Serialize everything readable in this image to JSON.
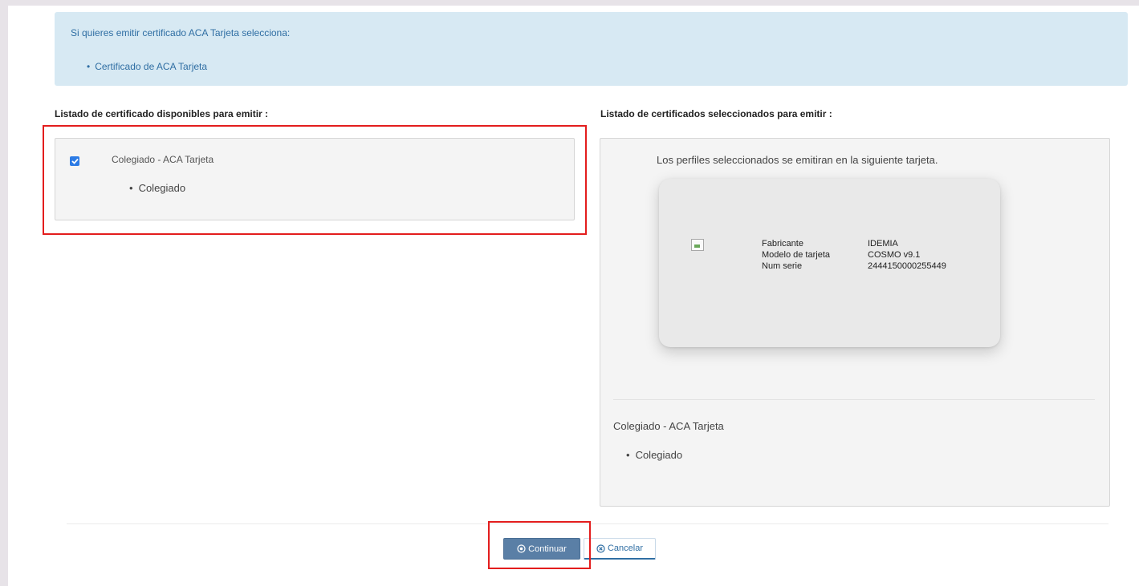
{
  "info": {
    "title": "Si quieres emitir certificado ACA Tarjeta selecciona:",
    "items": [
      "Certificado de ACA Tarjeta"
    ]
  },
  "available": {
    "heading": "Listado de certificado disponibles para emitir :",
    "item_name": "Colegiado - ACA Tarjeta",
    "item_checked": true,
    "item_profiles": [
      "Colegiado"
    ]
  },
  "selected": {
    "heading": "Listado de certificados seleccionados para emitir :",
    "intro": "Los perfiles seleccionados se emitiran en la siguiente tarjeta.",
    "card": {
      "rows": [
        {
          "label": "Fabricante",
          "value": "IDEMIA"
        },
        {
          "label": "Modelo de tarjeta",
          "value": "COSMO v9.1"
        },
        {
          "label": "Num serie",
          "value": "2444150000255449"
        }
      ]
    },
    "item_name": "Colegiado - ACA Tarjeta",
    "item_profiles": [
      "Colegiado"
    ]
  },
  "actions": {
    "continue_label": "Continuar",
    "cancel_label": "Cancelar"
  },
  "colors": {
    "highlight": "#e31d1d",
    "info_bg": "#d7e9f3",
    "primary_button": "#5a7fa6"
  },
  "icons": {
    "continue": "circle-arrow-icon",
    "cancel": "circle-x-icon",
    "card_image": "broken-image-icon"
  }
}
